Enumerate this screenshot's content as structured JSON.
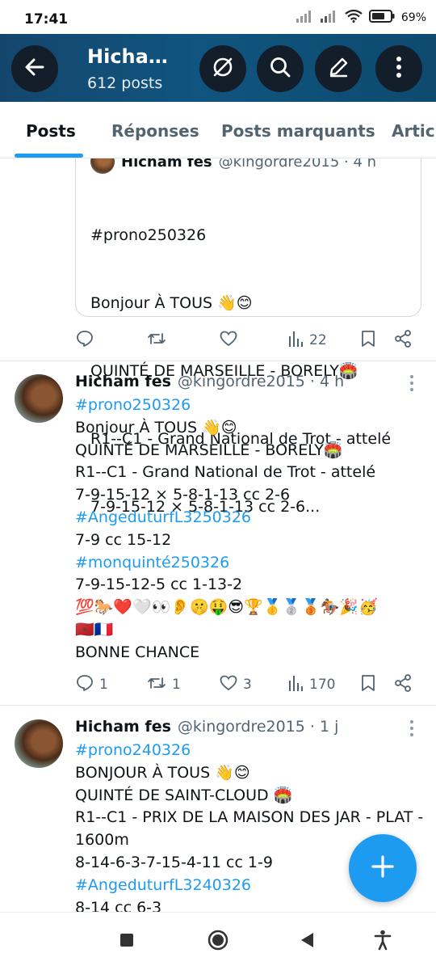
{
  "status_bar": {
    "time": "17:41",
    "battery": "69%"
  },
  "header": {
    "title": "Hicha…",
    "subtitle": "612 posts"
  },
  "tabs": [
    {
      "label": "Posts"
    },
    {
      "label": "Réponses"
    },
    {
      "label": "Posts marquants"
    },
    {
      "label": "Articl"
    }
  ],
  "quote": {
    "name": "Hicham fes",
    "meta": "@kingordre2015 · 4 h",
    "lines": [
      "#prono250326",
      "Bonjour À TOUS 👋😊",
      "QUINTÉ DE MARSEILLE - BORELY🏟️",
      "R1--C1 - Grand National de Trot - attelé",
      "7-9-15-12 × 5-8-1-13 cc 2-6..."
    ],
    "actions": {
      "replies": "",
      "reposts": "",
      "likes": "",
      "views": "22"
    }
  },
  "posts": [
    {
      "name": "Hicham fes",
      "meta": "@kingordre2015 · 4 h",
      "lines": [
        {
          "text": "#prono250326",
          "hashtag": true
        },
        {
          "text": "Bonjour À TOUS 👋😊",
          "hashtag": false
        },
        {
          "text": "QUINTÉ DE MARSEILLE - BORELY🏟️",
          "hashtag": false
        },
        {
          "text": "R1--C1 - Grand National de Trot - attelé",
          "hashtag": false
        },
        {
          "text": "7-9-15-12 × 5-8-1-13 cc 2-6",
          "hashtag": false
        },
        {
          "text": "#AngeduturfL3250326",
          "hashtag": true
        },
        {
          "text": "7-9 cc 15-12",
          "hashtag": false
        },
        {
          "text": "#monquinté250326",
          "hashtag": true
        },
        {
          "text": "7-9-15-12-5 cc 1-13-2",
          "hashtag": false
        },
        {
          "text": "💯🐎❤️🤍👀👂🤫🤑😎🏆🥇🥈🥉🏇🎉🥳",
          "hashtag": false
        },
        {
          "text": "🇲🇦🇫🇷",
          "hashtag": false
        },
        {
          "text": "BONNE CHANCE",
          "hashtag": false
        }
      ],
      "actions": {
        "replies": "1",
        "reposts": "1",
        "likes": "3",
        "views": "170"
      }
    },
    {
      "name": "Hicham fes",
      "meta": "@kingordre2015 · 1 j",
      "lines": [
        {
          "text": "#prono240326",
          "hashtag": true
        },
        {
          "text": "BONJOUR À TOUS 👋😊",
          "hashtag": false
        },
        {
          "text": "QUINTÉ DE SAINT-CLOUD 🏟️",
          "hashtag": false
        },
        {
          "text": "R1--C1 - PRIX DE LA MAISON DES JAR - PLAT -",
          "hashtag": false
        },
        {
          "text": "1600m",
          "hashtag": false
        },
        {
          "text": "8-14-6-3-7-15-4-11 cc 1-9",
          "hashtag": false
        },
        {
          "text": "#AngeduturfL3240326",
          "hashtag": true
        },
        {
          "text": "8-14 cc 6-3",
          "hashtag": false
        }
      ]
    }
  ],
  "colors": {
    "accent": "#1d9bf0",
    "header_bg": "#10557f",
    "muted": "#536471"
  }
}
